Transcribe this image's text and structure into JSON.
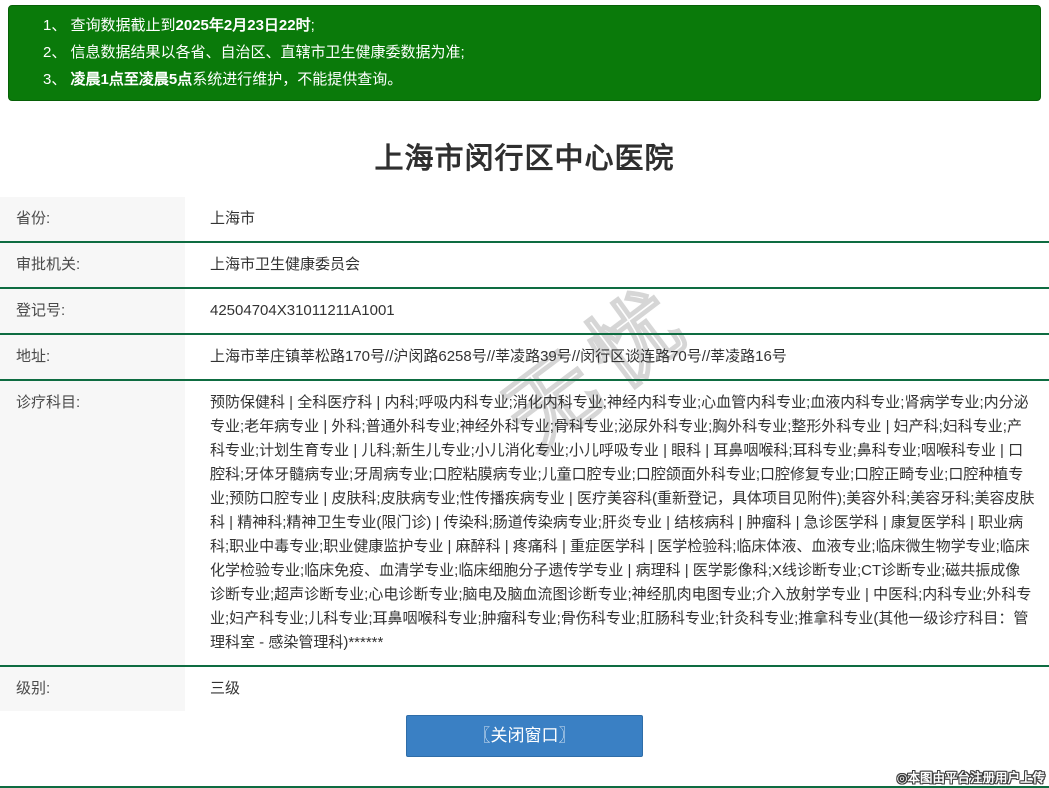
{
  "notice": {
    "lines": [
      {
        "pre": "1、 查询数据截止到",
        "bold": "2025年2月23日22时",
        "post": ";"
      },
      {
        "pre": "2、 信息数据结果以各省、自治区、直辖市卫生健康委数据为准;",
        "bold": "",
        "post": ""
      },
      {
        "pre": "3、 ",
        "bold": "凌晨1点至凌晨5点",
        "post": "系统进行维护，不能提供查询。"
      }
    ]
  },
  "title": "上海市闵行区中心医院",
  "table": {
    "rows": [
      {
        "label": "省份:",
        "value": "上海市"
      },
      {
        "label": "审批机关:",
        "value": "上海市卫生健康委员会"
      },
      {
        "label": "登记号:",
        "value": "42504704X31011211A1001"
      },
      {
        "label": "地址:",
        "value": "上海市莘庄镇莘松路170号//沪闵路6258号//莘凌路39号//闵行区谈连路70号//莘凌路16号"
      },
      {
        "label": "诊疗科目:",
        "value": "预防保健科 | 全科医疗科 | 内科;呼吸内科专业;消化内科专业;神经内科专业;心血管内科专业;血液内科专业;肾病学专业;内分泌专业;老年病专业 | 外科;普通外科专业;神经外科专业;骨科专业;泌尿外科专业;胸外科专业;整形外科专业 | 妇产科;妇科专业;产科专业;计划生育专业 | 儿科;新生儿专业;小儿消化专业;小儿呼吸专业 | 眼科 | 耳鼻咽喉科;耳科专业;鼻科专业;咽喉科专业 | 口腔科;牙体牙髓病专业;牙周病专业;口腔粘膜病专业;儿童口腔专业;口腔颌面外科专业;口腔修复专业;口腔正畸专业;口腔种植专业;预防口腔专业 | 皮肤科;皮肤病专业;性传播疾病专业 | 医疗美容科(重新登记，具体项目见附件);美容外科;美容牙科;美容皮肤科 | 精神科;精神卫生专业(限门诊) | 传染科;肠道传染病专业;肝炎专业 | 结核病科 | 肿瘤科 | 急诊医学科 | 康复医学科 | 职业病科;职业中毒专业;职业健康监护专业 | 麻醉科 | 疼痛科 | 重症医学科 | 医学检验科;临床体液、血液专业;临床微生物学专业;临床化学检验专业;临床免疫、血清学专业;临床细胞分子遗传学专业 | 病理科 | 医学影像科;X线诊断专业;CT诊断专业;磁共振成像诊断专业;超声诊断专业;心电诊断专业;脑电及脑血流图诊断专业;神经肌肉电图专业;介入放射学专业 | 中医科;内科专业;外科专业;妇产科专业;儿科专业;耳鼻咽喉科专业;肿瘤科专业;骨伤科专业;肛肠科专业;针灸科专业;推拿科专业(其他一级诊疗科目：管理科室 - 感染管理科)******"
      },
      {
        "label": "级别:",
        "value": "三级"
      }
    ]
  },
  "close_button_label": "〖关闭窗口〗",
  "watermark": {
    "diagonal_text": "无忧",
    "footer_credit": "◎本图由平台注册用户上传"
  },
  "colors": {
    "notice_green": "#0a7a0a",
    "separator_green": "#0e6c41",
    "button_blue": "#3a80c4",
    "label_bg": "#f7f7f7"
  }
}
